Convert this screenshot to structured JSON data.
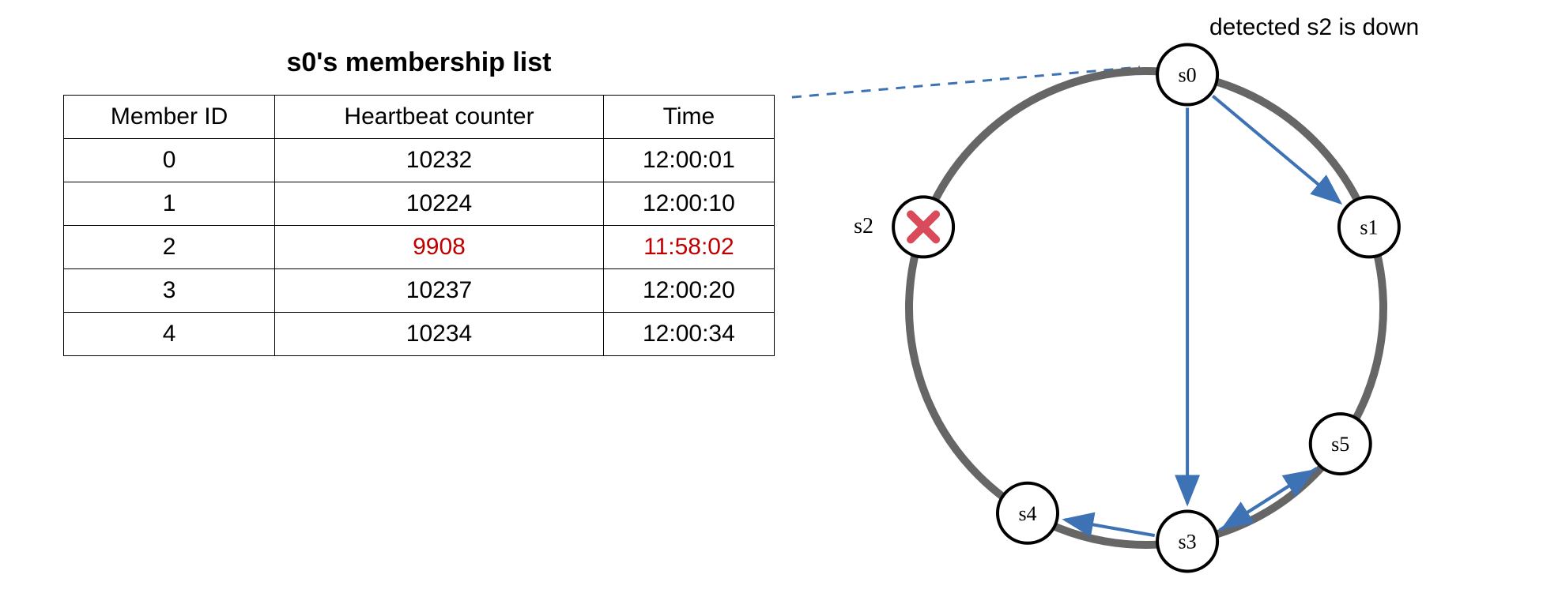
{
  "table": {
    "title": "s0's membership list",
    "headers": {
      "member": "Member ID",
      "heartbeat": "Heartbeat counter",
      "time": "Time"
    },
    "rows": [
      {
        "member": "0",
        "heartbeat": "10232",
        "time": "12:00:01",
        "stale": false
      },
      {
        "member": "1",
        "heartbeat": "10224",
        "time": "12:00:10",
        "stale": false
      },
      {
        "member": "2",
        "heartbeat": "9908",
        "time": "11:58:02",
        "stale": true
      },
      {
        "member": "3",
        "heartbeat": "10237",
        "time": "12:00:20",
        "stale": false
      },
      {
        "member": "4",
        "heartbeat": "10234",
        "time": "12:00:34",
        "stale": false
      }
    ]
  },
  "diagram": {
    "annotation": "detected s2 is down",
    "nodes": {
      "s0": "s0",
      "s1": "s1",
      "s2": "s2",
      "s3": "s3",
      "s4": "s4",
      "s5": "s5"
    },
    "ring_radius": 300,
    "node_radius": 38,
    "failed_node": "s2",
    "gossip_edges": [
      [
        "s0",
        "s1"
      ],
      [
        "s0",
        "s3"
      ],
      [
        "s3",
        "s5"
      ],
      [
        "s5",
        "s3"
      ],
      [
        "s3",
        "s4"
      ]
    ]
  },
  "colors": {
    "ring": "#666666",
    "arrow": "#3d72b4",
    "dash": "#3d72b4",
    "fail_x": "#d94a5b",
    "stale_text": "#c00000"
  }
}
